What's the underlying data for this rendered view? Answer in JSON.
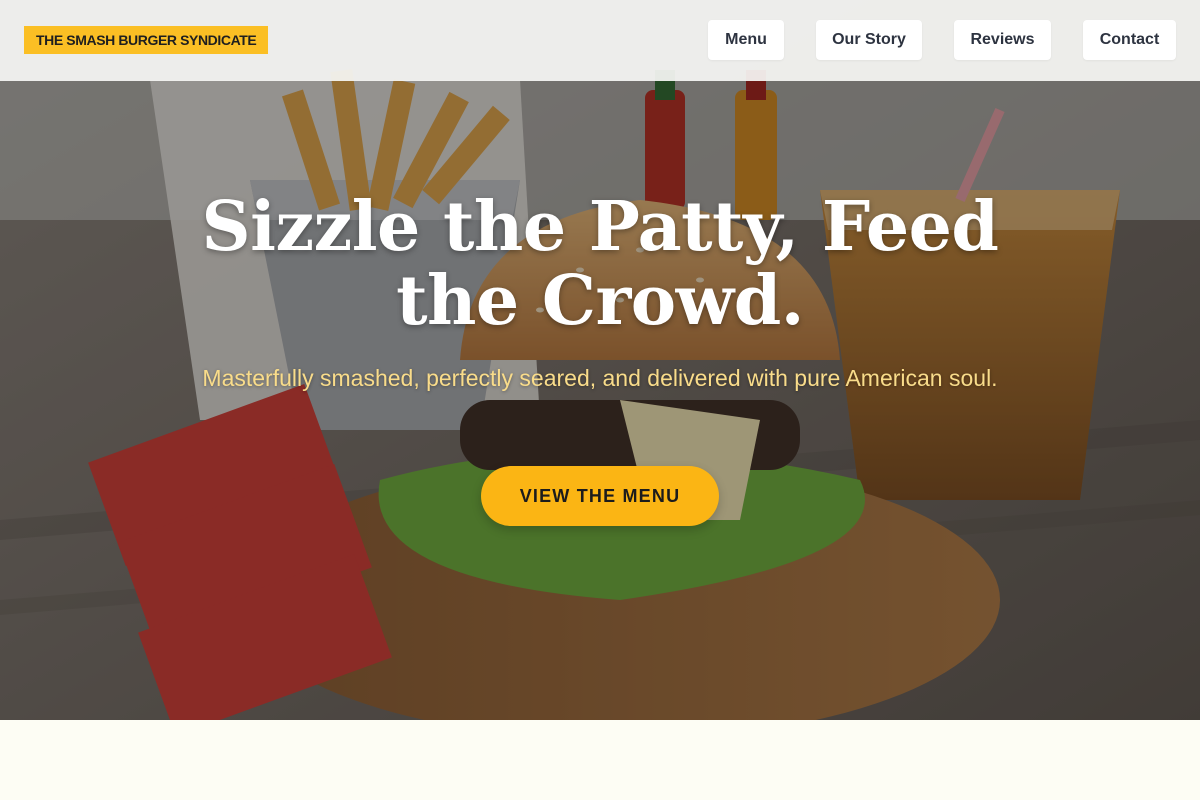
{
  "header": {
    "logo_text": "THE SMASH BURGER SYNDICATE",
    "nav": {
      "menu": "Menu",
      "story": "Our Story",
      "reviews": "Reviews",
      "contact": "Contact"
    }
  },
  "hero": {
    "headline": "Sizzle the Patty, Feed the Crowd.",
    "subheadline": "Masterfully smashed, perfectly seared, and delivered with pure American soul.",
    "cta_label": "VIEW THE MENU",
    "background_image": "burger-fries-drink-photo"
  },
  "colors": {
    "accent": "#fbbf24",
    "cta": "#fbb514",
    "subhead": "#f9dc8a",
    "page_bg": "#fdfdf4"
  }
}
